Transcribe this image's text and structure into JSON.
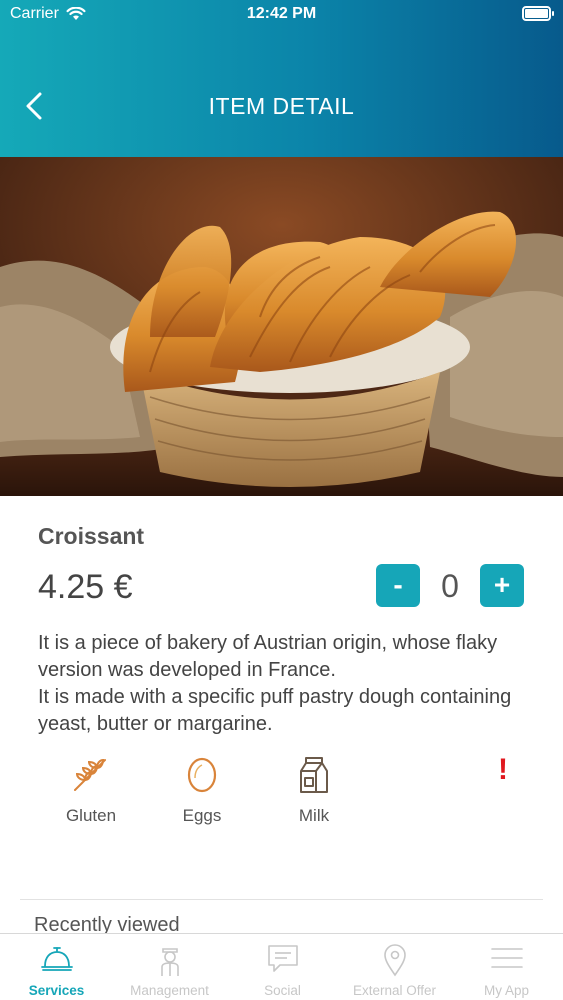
{
  "status_bar": {
    "carrier": "Carrier",
    "time": "12:42 PM"
  },
  "header": {
    "title": "ITEM DETAIL"
  },
  "item": {
    "name": "Croissant",
    "price": "4.25 €",
    "quantity": "0",
    "minus_label": "-",
    "plus_label": "+",
    "description_lines": [
      "It is a piece of bakery of Austrian origin, whose flaky version was developed in France.",
      "It is made with a specific puff pastry dough containing yeast, butter or margarine."
    ]
  },
  "allergens": [
    {
      "label": "Gluten",
      "icon": "wheat-icon"
    },
    {
      "label": "Eggs",
      "icon": "egg-icon"
    },
    {
      "label": "Milk",
      "icon": "milk-carton-icon"
    }
  ],
  "allergen_alert": "!",
  "recently_viewed": "Recently viewed",
  "tabs": [
    {
      "label": "Services",
      "icon": "service-bell-icon",
      "active": true
    },
    {
      "label": "Management",
      "icon": "staff-icon",
      "active": false
    },
    {
      "label": "Social",
      "icon": "chat-icon",
      "active": false
    },
    {
      "label": "External Offer",
      "icon": "location-pin-icon",
      "active": false
    },
    {
      "label": "My App",
      "icon": "menu-icon",
      "active": false
    }
  ],
  "colors": {
    "accent": "#16a6b8",
    "header_start": "#15a9b8",
    "header_end": "#075a8c",
    "alert": "#e0181f",
    "allergen_icon": "#d9843a",
    "allergen_icon_dark": "#6b5a4a"
  }
}
